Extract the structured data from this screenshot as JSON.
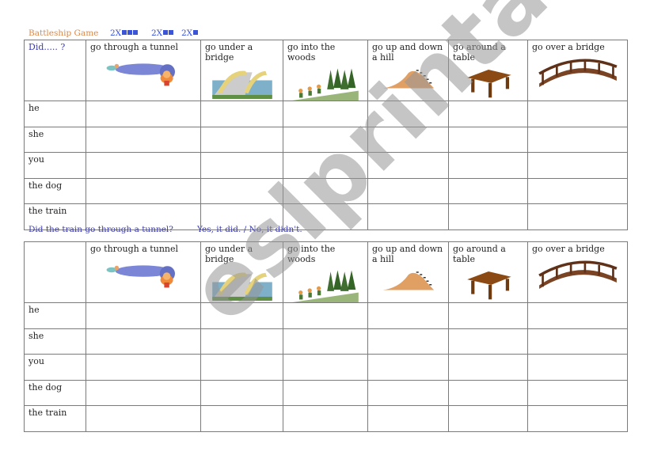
{
  "header": {
    "title": "Battleship Game",
    "ships": [
      {
        "label": "2X",
        "squares": 3
      },
      {
        "label": "2X",
        "squares": 2
      },
      {
        "label": "2X",
        "squares": 1
      }
    ],
    "square_color": "#3b55d6",
    "title_color": "#d9894a"
  },
  "table1": {
    "corner": "Did..... ?",
    "columns": [
      {
        "label": "go through a tunnel",
        "icon": "tunnel-icon"
      },
      {
        "label": "go under a bridge",
        "icon": "under-bridge-icon"
      },
      {
        "label": "go into the woods",
        "icon": "woods-icon"
      },
      {
        "label": "go up and down a hill",
        "icon": "hill-icon"
      },
      {
        "label": "go around a table",
        "icon": "table-icon"
      },
      {
        "label": "go over a bridge",
        "icon": "bridge-icon"
      }
    ],
    "rows": [
      "he",
      "she",
      "you",
      "the dog",
      "the train"
    ]
  },
  "prompt": {
    "question": "Did the train go through a tunnel?",
    "answer": "Yes, it did.  /  No, it didn't."
  },
  "table2": {
    "corner": "",
    "columns": [
      {
        "label": "go through a tunnel",
        "icon": "tunnel-icon"
      },
      {
        "label": "go under a bridge",
        "icon": "under-bridge-icon"
      },
      {
        "label": "go into the woods",
        "icon": "woods-icon"
      },
      {
        "label": "go up and down a hill",
        "icon": "hill-icon"
      },
      {
        "label": "go around a table",
        "icon": "table-icon"
      },
      {
        "label": "go over a bridge",
        "icon": "bridge-icon"
      }
    ],
    "rows": [
      "he",
      "she",
      "you",
      "the dog",
      "the train"
    ]
  },
  "watermark": "eslprintables.com"
}
